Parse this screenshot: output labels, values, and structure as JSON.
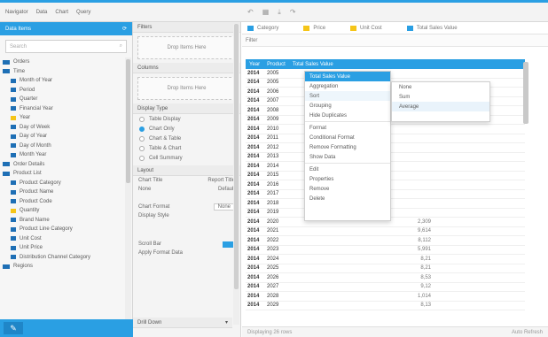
{
  "menubar": {
    "items": [
      "Navigator",
      "Data",
      "Chart",
      "Query"
    ]
  },
  "toolbar": {
    "icons": [
      "undo-icon",
      "table-icon",
      "export-icon",
      "redo-icon"
    ]
  },
  "data_panel": {
    "header": "Data Items",
    "search_placeholder": "Search",
    "tree": [
      {
        "label": "Orders",
        "kind": "folder"
      },
      {
        "label": "Time",
        "kind": "folder"
      },
      {
        "label": "Month of Year",
        "kind": "blue"
      },
      {
        "label": "Period",
        "kind": "blue"
      },
      {
        "label": "Quarter",
        "kind": "blue"
      },
      {
        "label": "Financial Year",
        "kind": "blue"
      },
      {
        "label": "Year",
        "kind": "yellow"
      },
      {
        "label": "Day of Week",
        "kind": "blue"
      },
      {
        "label": "Day of Year",
        "kind": "blue"
      },
      {
        "label": "Day of Month",
        "kind": "blue"
      },
      {
        "label": "Month Year",
        "kind": "blue"
      },
      {
        "label": "Order Details",
        "kind": "folder"
      },
      {
        "label": "Product List",
        "kind": "folder"
      },
      {
        "label": "Product Category",
        "kind": "blue"
      },
      {
        "label": "Product Name",
        "kind": "blue"
      },
      {
        "label": "Product Code",
        "kind": "blue"
      },
      {
        "label": "Quantity",
        "kind": "yellow"
      },
      {
        "label": "Brand Name",
        "kind": "blue"
      },
      {
        "label": "Product Line Category",
        "kind": "blue"
      },
      {
        "label": "Unit Cost",
        "kind": "blue"
      },
      {
        "label": "Unit Price",
        "kind": "blue"
      },
      {
        "label": "Distribution Channel Category",
        "kind": "blue"
      },
      {
        "label": "Regions",
        "kind": "folder"
      }
    ]
  },
  "middle_panel": {
    "filters_title": "Filters",
    "filters_drop": "Drop Items Here",
    "columns_title": "Columns",
    "columns_drop": "Drop Items Here",
    "display_title": "Display Type",
    "display_options": [
      {
        "label": "Table Display",
        "on": false
      },
      {
        "label": "Chart Only",
        "on": true
      },
      {
        "label": "Chart & Table",
        "on": false
      },
      {
        "label": "Table & Chart",
        "on": false
      },
      {
        "label": "Cell Summary",
        "on": false
      }
    ],
    "layout_title": "Layout",
    "layout_rows": [
      {
        "k": "Chart Title",
        "v": "Report Title"
      },
      {
        "k": "None",
        "v": "Default"
      }
    ],
    "format_label": "Chart Format",
    "format_value": "None",
    "label_text": "Display Style",
    "bar_label": "Scroll Bar",
    "footer_label": "Apply Format Data",
    "bottom_title": "Drill Down"
  },
  "main_panel": {
    "legend": [
      {
        "label": "Category",
        "color": "#2a9fe3"
      },
      {
        "label": "Price",
        "color": "#f5c518"
      },
      {
        "label": "Unit Cost",
        "color": "#f5c518"
      },
      {
        "label": "Total Sales Value",
        "color": "#2a9fe3"
      }
    ],
    "filter_text": "Filter",
    "grid_headers": [
      "Year",
      "Product",
      "Total Sales Value"
    ],
    "rows": [
      [
        "2014",
        "2005",
        "",
        ""
      ],
      [
        "2014",
        "2005",
        "",
        ""
      ],
      [
        "2014",
        "2006",
        "",
        ""
      ],
      [
        "2014",
        "2007",
        "",
        ""
      ],
      [
        "2014",
        "2008",
        "",
        ""
      ],
      [
        "2014",
        "2009",
        "",
        ""
      ],
      [
        "2014",
        "2010",
        "",
        ""
      ],
      [
        "2014",
        "2011",
        "",
        ""
      ],
      [
        "2014",
        "2012",
        "",
        ""
      ],
      [
        "2014",
        "2013",
        "",
        ""
      ],
      [
        "2014",
        "2014",
        "",
        ""
      ],
      [
        "2014",
        "2015",
        "",
        ""
      ],
      [
        "2014",
        "2016",
        "",
        ""
      ],
      [
        "2014",
        "2017",
        "",
        ""
      ],
      [
        "2014",
        "2018",
        "",
        ""
      ],
      [
        "2014",
        "2019",
        "",
        ""
      ],
      [
        "2014",
        "2020",
        "",
        "2,309"
      ],
      [
        "2014",
        "2021",
        "",
        "9,614"
      ],
      [
        "2014",
        "2022",
        "",
        "8,112"
      ],
      [
        "2014",
        "2023",
        "",
        "5,991"
      ],
      [
        "2014",
        "2024",
        "",
        "8,21"
      ],
      [
        "2014",
        "2025",
        "",
        "8,21"
      ],
      [
        "2014",
        "2026",
        "",
        "8,53"
      ],
      [
        "2014",
        "2027",
        "",
        "9,12"
      ],
      [
        "2014",
        "2028",
        "",
        "1,014"
      ],
      [
        "2014",
        "2029",
        "",
        "8,13"
      ]
    ],
    "status_left": "Displaying 26 rows",
    "status_right": "Auto Refresh"
  },
  "context_menu": {
    "items": [
      "Aggregation",
      "Sort",
      "Grouping",
      "Hide Duplicates",
      "Format",
      "Conditional Format",
      "Remove Formatting",
      "Show Data",
      "Edit",
      "Properties",
      "Remove",
      "Delete"
    ],
    "highlight": 1
  },
  "submenu": {
    "items": [
      "None",
      "Sum",
      "Average"
    ],
    "highlight": 2
  },
  "colors": {
    "accent": "#2a9fe3",
    "yellow": "#f5c518",
    "navy": "#1e6fb5"
  }
}
